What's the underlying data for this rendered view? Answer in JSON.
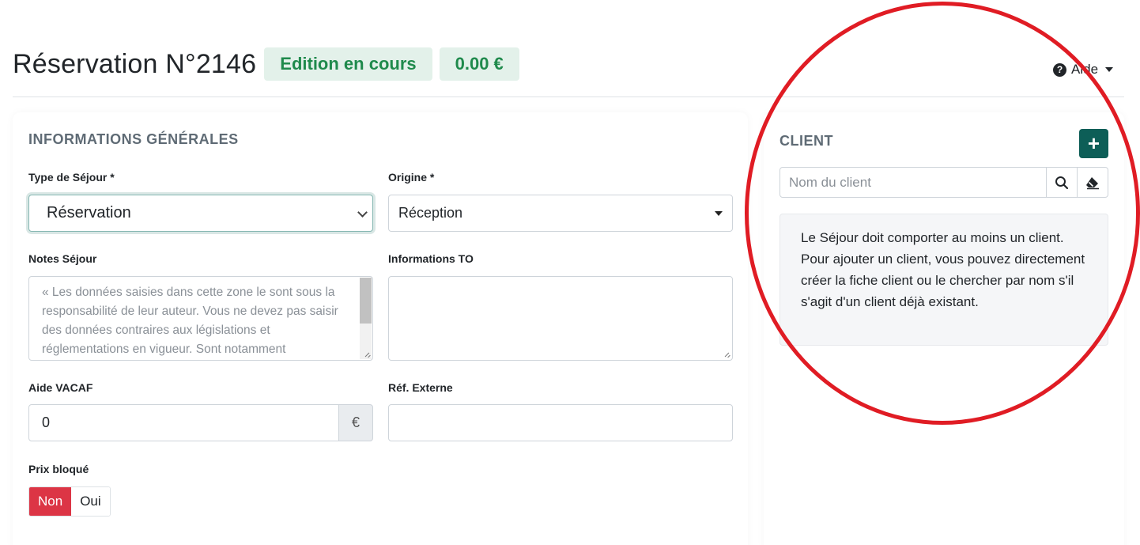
{
  "header": {
    "title": "Réservation N°2146",
    "status_badge": "Edition en cours",
    "price_badge": "0.00 €",
    "help_label": "Aide",
    "help_icon": "?"
  },
  "general": {
    "section_title": "INFORMATIONS GÉNÉRALES",
    "type_sejour": {
      "label": "Type de Séjour *",
      "value": "Réservation"
    },
    "origine": {
      "label": "Origine *",
      "value": "Réception"
    },
    "notes": {
      "label": "Notes Séjour",
      "placeholder": "« Les données saisies dans cette zone le sont sous la responsabilité de leur auteur. Vous ne devez pas saisir des données contraires aux législations et réglementations en vigueur. Sont notamment"
    },
    "informations_to": {
      "label": "Informations TO",
      "value": ""
    },
    "aide_vacaf": {
      "label": "Aide VACAF",
      "value": "0",
      "unit": "€"
    },
    "ref_externe": {
      "label": "Réf. Externe",
      "value": ""
    },
    "prix_bloque": {
      "label": "Prix bloqué",
      "options": [
        "Non",
        "Oui"
      ],
      "selected": "Non"
    }
  },
  "client": {
    "section_title": "CLIENT",
    "add_button": "+",
    "search_placeholder": "Nom du client",
    "info_text": "Le Séjour doit comporter au moins un client. Pour ajouter un client, vous pouvez directement créer la fiche client ou le chercher par nom s'il s'agit d'un client déjà existant."
  },
  "colors": {
    "badge_bg": "#e3f1ea",
    "badge_text": "#1f8a4c",
    "primary": "#0d5e57",
    "danger": "#dc3545",
    "annotation": "#e01c24"
  },
  "icons": [
    "question-circle-icon",
    "caret-down-icon",
    "chevron-down-icon",
    "plus-icon",
    "search-icon",
    "eraser-icon",
    "resize-handle-icon"
  ]
}
